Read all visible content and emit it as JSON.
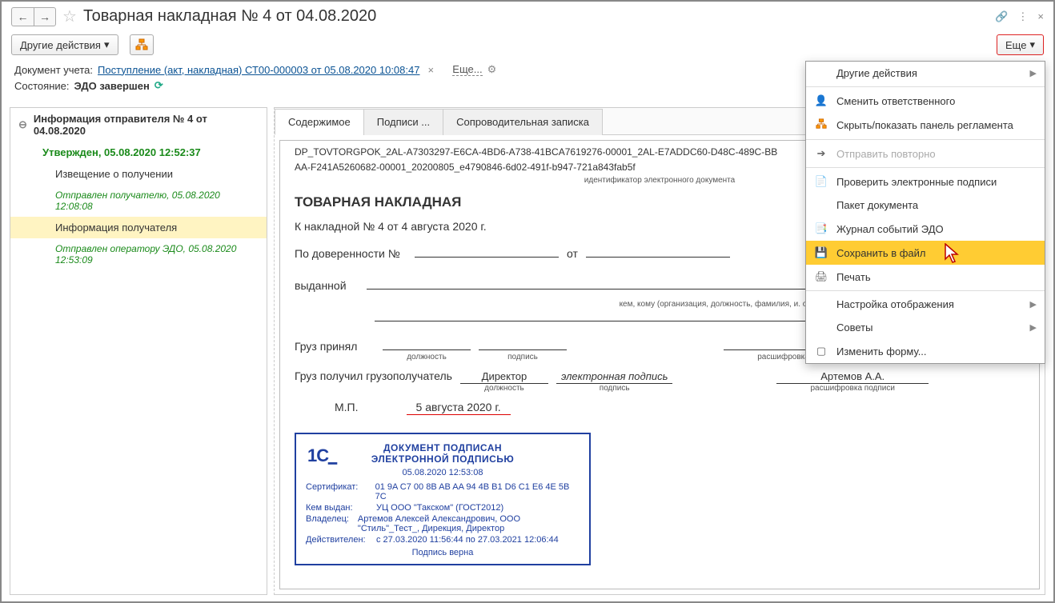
{
  "title": "Товарная накладная № 4 от 04.08.2020",
  "toolbar": {
    "other_actions": "Другие действия",
    "more": "Еще"
  },
  "info": {
    "doc_label": "Документ учета:",
    "doc_link": "Поступление (акт, накладная) СТ00-000003 от 05.08.2020 10:08:47",
    "more_link": "Еще...",
    "state_label": "Состояние:",
    "state_value": "ЭДО завершен"
  },
  "tree": {
    "header": "Информация отправителя № 4 от 04.08.2020",
    "approved": "Утвержден, 05.08.2020 12:52:37",
    "notice": "Извещение о получении",
    "notice_sent": "Отправлен получателю, 05.08.2020 12:08:08",
    "recipient_info": "Информация получателя",
    "sent_to_operator": "Отправлен оператору ЭДО, 05.08.2020 12:53:09"
  },
  "tabs": {
    "content": "Содержимое",
    "signatures": "Подписи ...",
    "note": "Сопроводительная записка"
  },
  "doc": {
    "id_line1": "DP_TOVTORGPOK_2AL-A7303297-E6CA-4BD6-A738-41BCA7619276-00001_2AL-E7ADDC60-D48C-489C-BB",
    "id_line2": "AA-F241A5260682-00001_20200805_e4790846-6d02-491f-b947-721a843fab5f",
    "id_label": "идентификатор электронного документа",
    "title": "ТОВАРНАЯ НАКЛАДНАЯ",
    "subtitle": "К накладной № 4 от 4 августа 2020 г.",
    "proxy_label": "По доверенности №",
    "from_label": "от",
    "issued_label": "выданной",
    "issued_hint": "кем, кому (организация, должность, фамилия, и. о.)",
    "cargo_accepted": "Груз принял",
    "cargo_received": "Груз получил грузополучатель",
    "position_label": "должность",
    "signature_label": "подпись",
    "decrypt_label": "расшифровка подписи",
    "director": "Директор",
    "esig": "электронная подпись",
    "person": "Артемов А.А.",
    "mp": "М.П.",
    "date": "5 августа 2020 г."
  },
  "stamp": {
    "header1": "ДОКУМЕНТ ПОДПИСАН",
    "header2": "ЭЛЕКТРОННОЙ ПОДПИСЬЮ",
    "date": "05.08.2020 12:53:08",
    "cert_label": "Сертификат:",
    "cert": "01 9A C7 00 8B AB AA 94 4B B1 D6 C1 E6 4E 5B 7C",
    "issued_label": "Кем выдан:",
    "issued": "УЦ ООО \"Такском\" (ГОСТ2012)",
    "owner_label": "Владелец:",
    "owner": "Артемов Алексей Александрович, ООО \"Стиль\"_Тест_, Дирекция, Директор",
    "valid_label": "Действителен:",
    "valid": "с 27.03.2020 11:56:44 по 27.03.2021 12:06:44",
    "footer": "Подпись верна"
  },
  "menu": {
    "other_actions": "Другие действия",
    "change_responsible": "Сменить ответственного",
    "toggle_panel": "Скрыть/показать панель регламента",
    "resend": "Отправить повторно",
    "verify": "Проверить электронные подписи",
    "package": "Пакет документа",
    "log": "Журнал событий ЭДО",
    "save_file": "Сохранить в файл",
    "print": "Печать",
    "display_settings": "Настройка отображения",
    "tips": "Советы",
    "change_form": "Изменить форму..."
  }
}
